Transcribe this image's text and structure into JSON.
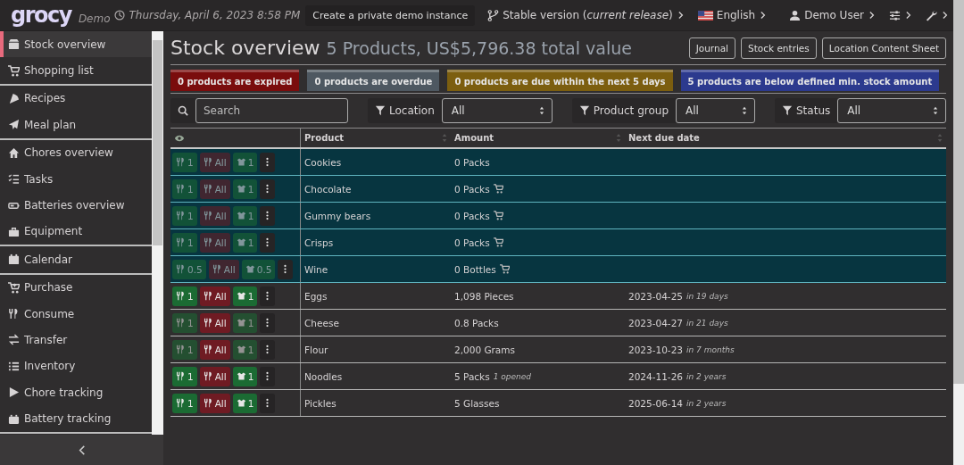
{
  "header": {
    "logo": "grocy",
    "subtitle": "Demo",
    "datetime": "Thursday, April 6, 2023 8:58 PM",
    "demo_button": "Create a private demo instance",
    "version": "Stable version (*current release*)",
    "language": "English",
    "user": "Demo User"
  },
  "sidebar": {
    "groups": [
      {
        "items": [
          {
            "label": "Stock overview",
            "selected": true
          },
          {
            "label": "Shopping list",
            "selected": false
          }
        ]
      },
      {
        "items": [
          {
            "label": "Recipes",
            "selected": false
          },
          {
            "label": "Meal plan",
            "selected": false
          }
        ]
      },
      {
        "items": [
          {
            "label": "Chores overview",
            "selected": false
          },
          {
            "label": "Tasks",
            "selected": false
          },
          {
            "label": "Batteries overview",
            "selected": false
          },
          {
            "label": "Equipment",
            "selected": false
          }
        ]
      },
      {
        "items": [
          {
            "label": "Calendar",
            "selected": false
          }
        ]
      },
      {
        "items": [
          {
            "label": "Purchase",
            "selected": false
          },
          {
            "label": "Consume",
            "selected": false
          },
          {
            "label": "Transfer",
            "selected": false
          },
          {
            "label": "Inventory",
            "selected": false
          },
          {
            "label": "Chore tracking",
            "selected": false
          },
          {
            "label": "Battery tracking",
            "selected": false
          }
        ]
      }
    ]
  },
  "page": {
    "title": "Stock overview",
    "summary": "5 Products, US$5,796.38 total value",
    "buttons": [
      "Journal",
      "Stock entries",
      "Location Content Sheet"
    ]
  },
  "alerts": [
    {
      "text": "0 products are expired",
      "color": "#7a0d0d"
    },
    {
      "text": "0 products are overdue",
      "color": "#4e5861"
    },
    {
      "text": "0 products are due within the next 5 days",
      "color": "#7c5e0f"
    },
    {
      "text": "5 products are below defined min. stock amount",
      "color": "#2c3a8e"
    }
  ],
  "filters": {
    "search": {
      "placeholder": "Search"
    },
    "selects": [
      {
        "label": "Location",
        "value": "All"
      },
      {
        "label": "Product group",
        "value": "All"
      },
      {
        "label": "Status",
        "value": "All"
      }
    ]
  },
  "table": {
    "columns": [
      "Product",
      "Amount",
      "Next due date"
    ],
    "rows": [
      {
        "below_min": true,
        "actions": [
          {
            "kind": "consume",
            "label": "1",
            "disabled": true
          },
          {
            "kind": "consume_all",
            "label": "All",
            "disabled": true
          },
          {
            "kind": "open",
            "label": "1",
            "disabled": true
          }
        ],
        "product": "Cookies",
        "amount": "0 Packs",
        "on_list": false
      },
      {
        "below_min": true,
        "actions": [
          {
            "kind": "consume",
            "label": "1",
            "disabled": true
          },
          {
            "kind": "consume_all",
            "label": "All",
            "disabled": true
          },
          {
            "kind": "open",
            "label": "1",
            "disabled": true
          }
        ],
        "product": "Chocolate",
        "amount": "0 Packs",
        "on_list": true
      },
      {
        "below_min": true,
        "actions": [
          {
            "kind": "consume",
            "label": "1",
            "disabled": true
          },
          {
            "kind": "consume_all",
            "label": "All",
            "disabled": true
          },
          {
            "kind": "open",
            "label": "1",
            "disabled": true
          }
        ],
        "product": "Gummy bears",
        "amount": "0 Packs",
        "on_list": true
      },
      {
        "below_min": true,
        "actions": [
          {
            "kind": "consume",
            "label": "1",
            "disabled": true
          },
          {
            "kind": "consume_all",
            "label": "All",
            "disabled": true
          },
          {
            "kind": "open",
            "label": "1",
            "disabled": true
          }
        ],
        "product": "Crisps",
        "amount": "0 Packs",
        "on_list": true
      },
      {
        "below_min": true,
        "actions": [
          {
            "kind": "consume",
            "label": "0.5",
            "disabled": true
          },
          {
            "kind": "consume_all",
            "label": "All",
            "disabled": true
          },
          {
            "kind": "open",
            "label": "0.5",
            "disabled": true
          }
        ],
        "product": "Wine",
        "amount": "0 Bottles",
        "on_list": true
      },
      {
        "below_min": false,
        "actions": [
          {
            "kind": "consume",
            "label": "1",
            "disabled": false
          },
          {
            "kind": "consume_all",
            "label": "All",
            "disabled": false
          },
          {
            "kind": "open",
            "label": "1",
            "disabled": false
          }
        ],
        "product": "Eggs",
        "amount": "1,098 Pieces",
        "on_list": false,
        "due_date": "2023-04-25",
        "due_relative": "in 19 days"
      },
      {
        "below_min": false,
        "actions": [
          {
            "kind": "consume",
            "label": "1",
            "disabled": true
          },
          {
            "kind": "consume_all",
            "label": "All",
            "disabled": false
          },
          {
            "kind": "open",
            "label": "1",
            "disabled": true
          }
        ],
        "product": "Cheese",
        "amount": "0.8 Packs",
        "on_list": false,
        "due_date": "2023-04-27",
        "due_relative": "in 21 days"
      },
      {
        "below_min": false,
        "actions": [
          {
            "kind": "consume",
            "label": "1",
            "disabled": true
          },
          {
            "kind": "consume_all",
            "label": "All",
            "disabled": false
          },
          {
            "kind": "open",
            "label": "1",
            "disabled": true
          }
        ],
        "product": "Flour",
        "amount": "2,000 Grams",
        "on_list": false,
        "due_date": "2023-10-23",
        "due_relative": "in 7 months"
      },
      {
        "below_min": false,
        "actions": [
          {
            "kind": "consume",
            "label": "1",
            "disabled": false
          },
          {
            "kind": "consume_all",
            "label": "All",
            "disabled": false
          },
          {
            "kind": "open",
            "label": "1",
            "disabled": false
          }
        ],
        "product": "Noodles",
        "amount": "5 Packs",
        "amount_note": "1 opened",
        "on_list": false,
        "due_date": "2024-11-26",
        "due_relative": "in 2 years"
      },
      {
        "below_min": false,
        "actions": [
          {
            "kind": "consume",
            "label": "1",
            "disabled": false
          },
          {
            "kind": "consume_all",
            "label": "All",
            "disabled": false
          },
          {
            "kind": "open",
            "label": "1",
            "disabled": false
          }
        ],
        "product": "Pickles",
        "amount": "5 Glasses",
        "on_list": false,
        "due_date": "2025-06-14",
        "due_relative": "in 2 years"
      }
    ]
  }
}
